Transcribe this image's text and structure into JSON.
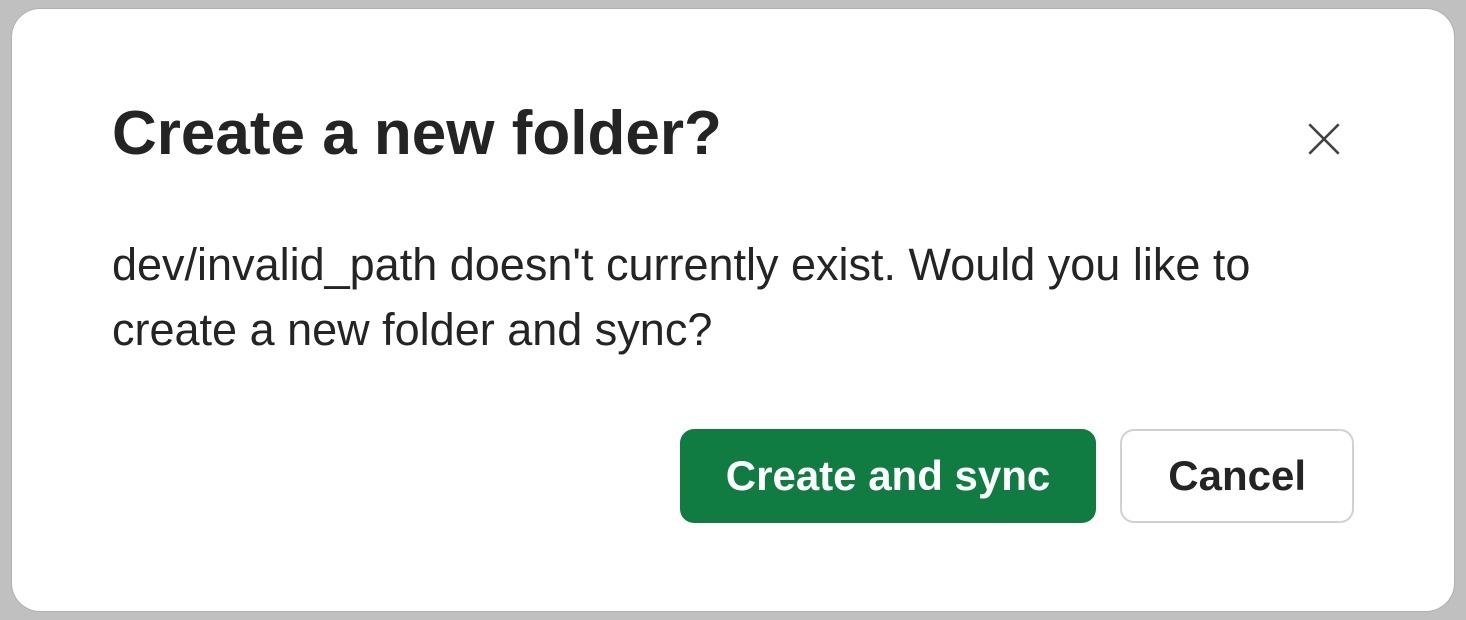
{
  "dialog": {
    "title": "Create a new folder?",
    "message": "dev/invalid_path doesn't currently exist. Would you like to create a new folder and sync?",
    "primary_button_label": "Create and sync",
    "secondary_button_label": "Cancel"
  }
}
